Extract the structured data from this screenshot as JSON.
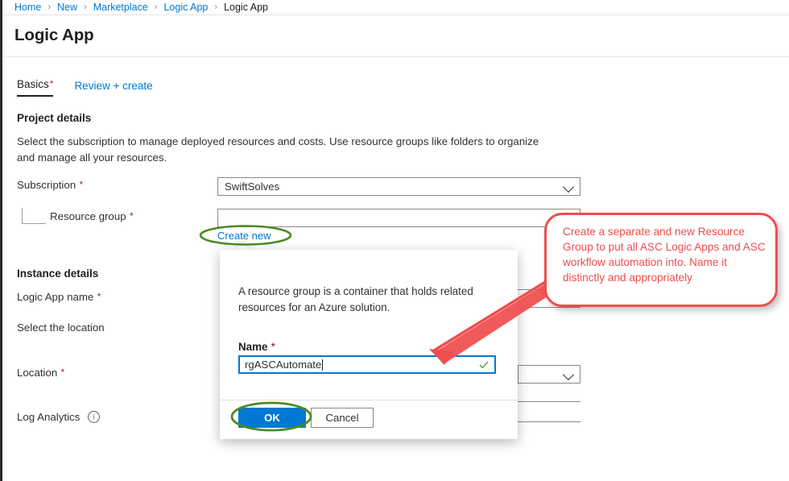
{
  "breadcrumb": {
    "items": [
      {
        "label": "Home",
        "current": false
      },
      {
        "label": "New",
        "current": false
      },
      {
        "label": "Marketplace",
        "current": false
      },
      {
        "label": "Logic App",
        "current": false
      },
      {
        "label": "Logic App",
        "current": true
      }
    ],
    "separator": "›"
  },
  "header": {
    "title": "Logic App"
  },
  "tabs": [
    {
      "label": "Basics",
      "required": true,
      "active": true
    },
    {
      "label": "Review + create",
      "required": false,
      "active": false
    }
  ],
  "form": {
    "project_details": {
      "heading": "Project details",
      "description": "Select the subscription to manage deployed resources and costs. Use resource groups like folders to organize and manage all your resources.",
      "subscription": {
        "label": "Subscription",
        "required_mark": "*",
        "value": "SwiftSolves"
      },
      "resource_group": {
        "label": "Resource group",
        "required_mark": "*",
        "value": "",
        "create_new_link": "Create new"
      }
    },
    "instance_details": {
      "heading": "Instance details",
      "logic_app_name": {
        "label": "Logic App name",
        "required_mark": "*",
        "value": ""
      },
      "select_location": {
        "label": "Select the location"
      },
      "location": {
        "label": "Location",
        "required_mark": "*",
        "value": ""
      },
      "log_analytics": {
        "label": "Log Analytics",
        "info_icon": "i"
      }
    }
  },
  "dialog": {
    "description": "A resource group is a container that holds related resources for an Azure solution.",
    "name_label": "Name",
    "name_required_mark": "*",
    "name_value": "rgASCAutomate",
    "validation_icon": "check-icon",
    "ok_button": "OK",
    "cancel_button": "Cancel"
  },
  "annotations": {
    "callout_text": "Create a separate and new Resource Group to put all ASC Logic Apps and ASC workflow automation into. Name it distinctly and appropriately",
    "callout_color": "#ef4d4d",
    "highlight_color": "#4b8b1f",
    "highlighted_elements": [
      "create-new-link",
      "ok-button"
    ]
  },
  "colors": {
    "accent": "#0078d4",
    "required": "#a4262c",
    "text": "#323130",
    "annotation_red": "#ef4d4d",
    "annotation_green": "#4b8b1f"
  }
}
